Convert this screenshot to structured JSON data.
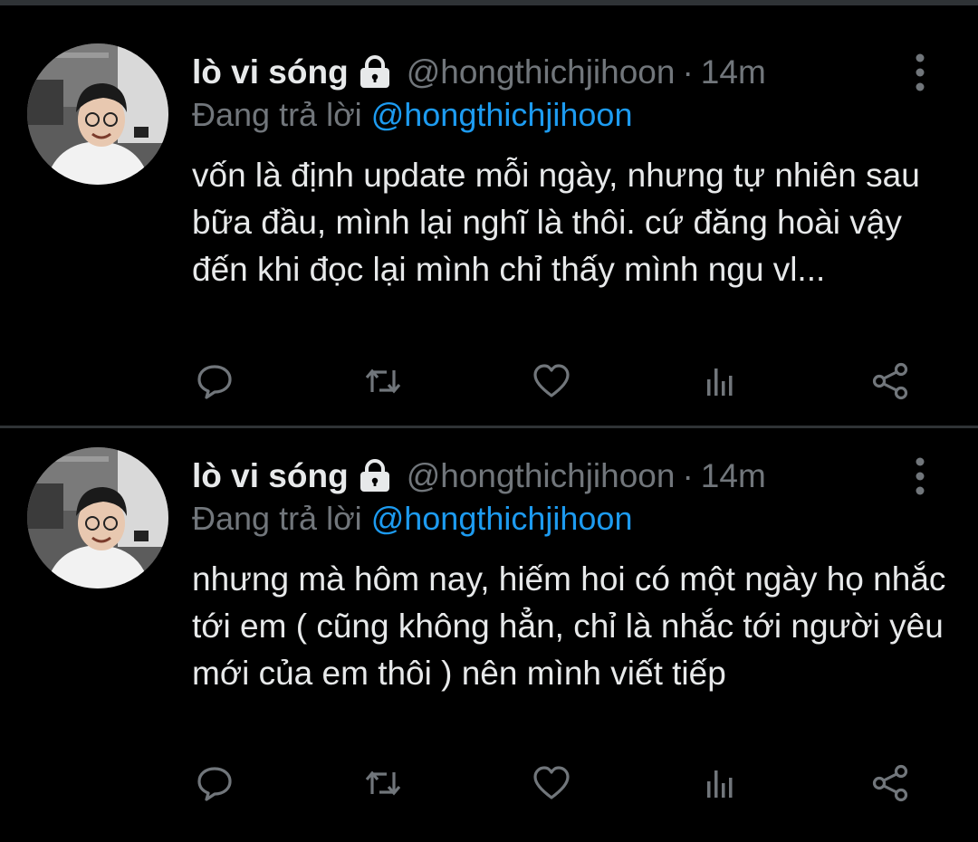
{
  "tweets": [
    {
      "name": "lò vi sóng",
      "handle": "@hongthichjihoon",
      "separator": "·",
      "time": "14m",
      "reply_prefix": "Đang trả lời",
      "reply_to": "@hongthichjihoon",
      "text": "vốn là định update mỗi ngày, nhưng tự nhiên sau bữa đầu, mình lại nghĩ là thôi. cứ đăng hoài vậy đến khi đọc lại mình chỉ thấy mình ngu vl..."
    },
    {
      "name": "lò vi sóng",
      "handle": "@hongthichjihoon",
      "separator": "·",
      "time": "14m",
      "reply_prefix": "Đang trả lời",
      "reply_to": "@hongthichjihoon",
      "text": "nhưng mà hôm nay, hiếm hoi có một ngày họ nhắc tới em ( cũng không hẳn, chỉ là nhắc tới người yêu mới của em thôi ) nên mình viết tiếp"
    }
  ],
  "icons": {
    "lock": "lock-icon",
    "more": "more-vertical-icon",
    "reply": "reply-icon",
    "retweet": "retweet-icon",
    "like": "heart-icon",
    "stats": "stats-icon",
    "share": "share-icon"
  },
  "colors": {
    "background": "#000000",
    "text": "#e7e9ea",
    "muted": "#71767b",
    "link": "#1d9bf0",
    "divider": "#2f3336"
  }
}
